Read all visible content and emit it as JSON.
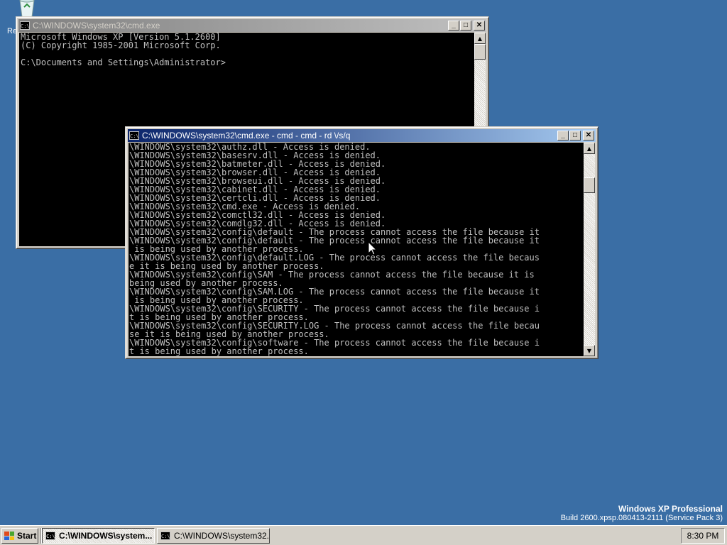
{
  "desktop": {
    "recycle_label": "Re",
    "watermark": {
      "line1": "Windows XP Professional",
      "line2": "Build 2600.xpsp.080413-2111 (Service Pack 3)"
    }
  },
  "window_back": {
    "title": "C:\\WINDOWS\\system32\\cmd.exe",
    "icon_text": "C:\\",
    "lines": [
      "Microsoft Windows XP [Version 5.1.2600]",
      "(C) Copyright 1985-2001 Microsoft Corp.",
      "",
      "C:\\Documents and Settings\\Administrator>"
    ]
  },
  "window_front": {
    "title": "C:\\WINDOWS\\system32\\cmd.exe - cmd - cmd - rd \\/s/q",
    "icon_text": "C:\\",
    "lines": [
      "\\WINDOWS\\system32\\authz.dll - Access is denied.",
      "\\WINDOWS\\system32\\basesrv.dll - Access is denied.",
      "\\WINDOWS\\system32\\batmeter.dll - Access is denied.",
      "\\WINDOWS\\system32\\browser.dll - Access is denied.",
      "\\WINDOWS\\system32\\browseui.dll - Access is denied.",
      "\\WINDOWS\\system32\\cabinet.dll - Access is denied.",
      "\\WINDOWS\\system32\\certcli.dll - Access is denied.",
      "\\WINDOWS\\system32\\cmd.exe - Access is denied.",
      "\\WINDOWS\\system32\\comctl32.dll - Access is denied.",
      "\\WINDOWS\\system32\\comdlg32.dll - Access is denied.",
      "\\WINDOWS\\system32\\config\\default - The process cannot access the file because it",
      "\\WINDOWS\\system32\\config\\default - The process cannot access the file because it",
      " is being used by another process.",
      "\\WINDOWS\\system32\\config\\default.LOG - The process cannot access the file becaus",
      "e it is being used by another process.",
      "\\WINDOWS\\system32\\config\\SAM - The process cannot access the file because it is",
      "being used by another process.",
      "\\WINDOWS\\system32\\config\\SAM.LOG - The process cannot access the file because it",
      " is being used by another process.",
      "\\WINDOWS\\system32\\config\\SECURITY - The process cannot access the file because i",
      "t is being used by another process.",
      "\\WINDOWS\\system32\\config\\SECURITY.LOG - The process cannot access the file becau",
      "se it is being used by another process.",
      "\\WINDOWS\\system32\\config\\software - The process cannot access the file because i",
      "t is being used by another process."
    ]
  },
  "taskbar": {
    "start_label": "Start",
    "tasks": [
      {
        "label": "C:\\WINDOWS\\system...",
        "icon_text": "C:\\"
      },
      {
        "label": "C:\\WINDOWS\\system32...",
        "icon_text": "C:\\"
      }
    ],
    "clock": "8:30 PM"
  }
}
